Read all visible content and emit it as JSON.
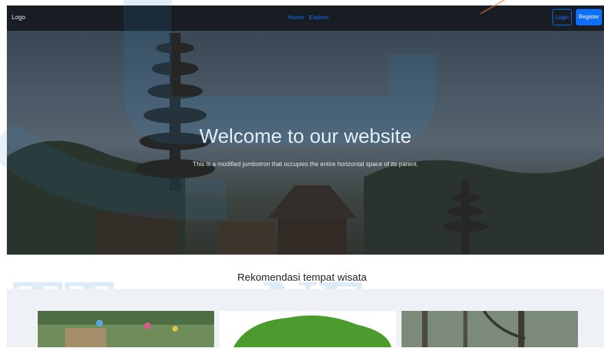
{
  "navbar": {
    "logo": "Logo",
    "links": [
      "Home",
      "Explore"
    ],
    "login_label": "Login",
    "register_label": "Register"
  },
  "hero": {
    "title": "Welcome to our website",
    "subtitle": "This is a modified jumbotron that occupies the entire horizontal space of its parent."
  },
  "section": {
    "title": "Rekomendasi tempat wisata"
  },
  "colors": {
    "primary": "#0d6efd",
    "navbar_bg": "#14181e",
    "watermark": "#2a86c8"
  }
}
